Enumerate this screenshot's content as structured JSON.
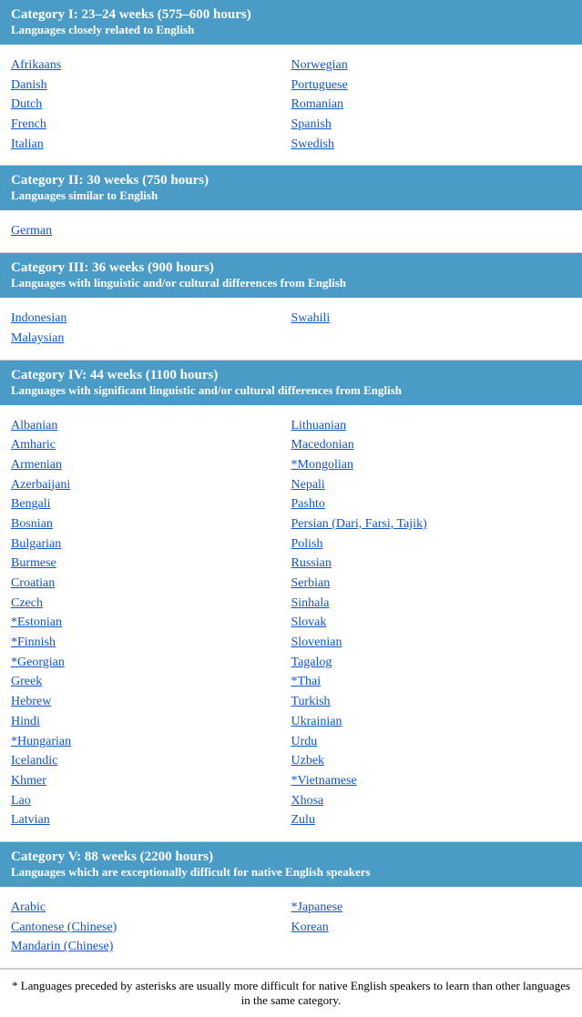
{
  "categories": [
    {
      "id": "cat1",
      "title": "Category I: 23–24 weeks (575–600 hours)",
      "subtitle": "Languages closely related to English",
      "layout": "two-col",
      "col1": [
        {
          "text": "Afrikaans",
          "href": "#"
        },
        {
          "text": "Danish",
          "href": "#"
        },
        {
          "text": "Dutch",
          "href": "#"
        },
        {
          "text": "French",
          "href": "#"
        },
        {
          "text": "Italian",
          "href": "#"
        }
      ],
      "col2": [
        {
          "text": "Norwegian",
          "href": "#"
        },
        {
          "text": "Portuguese",
          "href": "#"
        },
        {
          "text": "Romanian",
          "href": "#"
        },
        {
          "text": "Spanish",
          "href": "#"
        },
        {
          "text": "Swedish",
          "href": "#"
        }
      ]
    },
    {
      "id": "cat2",
      "title": "Category II: 30 weeks (750 hours)",
      "subtitle": "Languages similar to English",
      "layout": "two-col",
      "col1": [
        {
          "text": "German",
          "href": "#"
        }
      ],
      "col2": []
    },
    {
      "id": "cat3",
      "title": "Category III: 36 weeks (900 hours)",
      "subtitle": "Languages with linguistic and/or cultural differences from English",
      "layout": "two-col",
      "col1": [
        {
          "text": "Indonesian",
          "href": "#"
        },
        {
          "text": "Malaysian",
          "href": "#"
        }
      ],
      "col2": [
        {
          "text": "Swahili",
          "href": "#"
        }
      ]
    },
    {
      "id": "cat4",
      "title": "Category IV: 44 weeks (1100 hours)",
      "subtitle": "Languages with significant linguistic and/or cultural differences from English",
      "layout": "two-col",
      "col1": [
        {
          "text": "Albanian",
          "href": "#"
        },
        {
          "text": "Amharic",
          "href": "#"
        },
        {
          "text": "Armenian",
          "href": "#"
        },
        {
          "text": "Azerbaijani",
          "href": "#"
        },
        {
          "text": "Bengali",
          "href": "#"
        },
        {
          "text": "Bosnian",
          "href": "#"
        },
        {
          "text": "Bulgarian",
          "href": "#"
        },
        {
          "text": "Burmese",
          "href": "#"
        },
        {
          "text": "Croatian",
          "href": "#"
        },
        {
          "text": "Czech",
          "href": "#"
        },
        {
          "text": "*Estonian",
          "href": "#"
        },
        {
          "text": "*Finnish",
          "href": "#"
        },
        {
          "text": "*Georgian",
          "href": "#"
        },
        {
          "text": "Greek",
          "href": "#"
        },
        {
          "text": "Hebrew",
          "href": "#"
        },
        {
          "text": "Hindi",
          "href": "#"
        },
        {
          "text": "*Hungarian",
          "href": "#"
        },
        {
          "text": "Icelandic",
          "href": "#"
        },
        {
          "text": "Khmer",
          "href": "#"
        },
        {
          "text": "Lao",
          "href": "#"
        },
        {
          "text": "Latvian",
          "href": "#"
        }
      ],
      "col2": [
        {
          "text": "Lithuanian",
          "href": "#"
        },
        {
          "text": "Macedonian",
          "href": "#"
        },
        {
          "text": "*Mongolian",
          "href": "#"
        },
        {
          "text": "Nepali",
          "href": "#"
        },
        {
          "text": "Pashto",
          "href": "#"
        },
        {
          "text": "Persian (Dari, Farsi, Tajik)",
          "href": "#"
        },
        {
          "text": "Polish",
          "href": "#"
        },
        {
          "text": "Russian",
          "href": "#"
        },
        {
          "text": "Serbian",
          "href": "#"
        },
        {
          "text": "Sinhala",
          "href": "#"
        },
        {
          "text": "Slovak",
          "href": "#"
        },
        {
          "text": "Slovenian",
          "href": "#"
        },
        {
          "text": "Tagalog",
          "href": "#"
        },
        {
          "text": "*Thai",
          "href": "#"
        },
        {
          "text": "Turkish",
          "href": "#"
        },
        {
          "text": "Ukrainian",
          "href": "#"
        },
        {
          "text": "Urdu",
          "href": "#"
        },
        {
          "text": "Uzbek",
          "href": "#"
        },
        {
          "text": "*Vietnamese",
          "href": "#"
        },
        {
          "text": "Xhosa",
          "href": "#"
        },
        {
          "text": "Zulu",
          "href": "#"
        }
      ]
    },
    {
      "id": "cat5",
      "title": "Category V: 88 weeks (2200 hours)",
      "subtitle": "Languages which are exceptionally difficult for native English speakers",
      "layout": "two-col",
      "col1": [
        {
          "text": "Arabic",
          "href": "#"
        },
        {
          "text": "Cantonese (Chinese)",
          "href": "#"
        },
        {
          "text": "Mandarin (Chinese)",
          "href": "#"
        }
      ],
      "col2": [
        {
          "text": "*Japanese",
          "href": "#"
        },
        {
          "text": "Korean",
          "href": "#"
        }
      ]
    }
  ],
  "footnote": "* Languages preceded by asterisks are usually more difficult for native English speakers to learn than other languages in the same category."
}
